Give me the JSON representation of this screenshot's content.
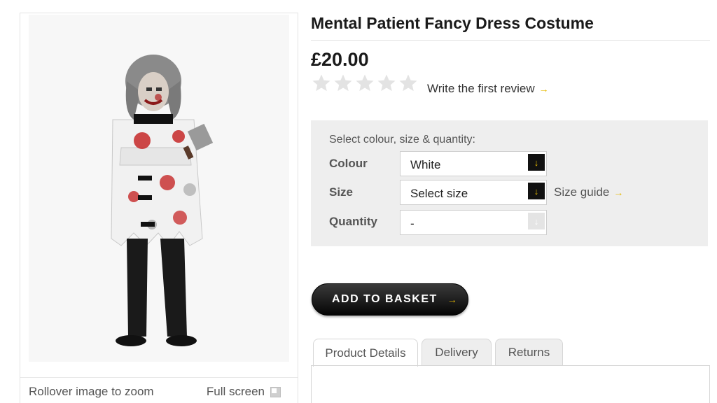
{
  "product": {
    "title": "Mental Patient Fancy Dress Costume",
    "price": "£20.00",
    "rating_stars": 0,
    "rating_max": 5,
    "review_link": "Write the first review"
  },
  "image_panel": {
    "zoom_text": "Rollover image to zoom",
    "fullscreen_label": "Full screen"
  },
  "options": {
    "heading": "Select colour, size & quantity:",
    "colour_label": "Colour",
    "colour_value": "White",
    "size_label": "Size",
    "size_value": "Select size",
    "size_guide": "Size guide",
    "quantity_label": "Quantity",
    "quantity_value": "-"
  },
  "actions": {
    "add_to_basket": "ADD TO BASKET"
  },
  "tabs": [
    {
      "label": "Product Details"
    },
    {
      "label": "Delivery"
    },
    {
      "label": "Returns"
    }
  ],
  "tab_content_partial": "",
  "colors": {
    "accent": "#e6b800",
    "button_dark": "#111111",
    "panel_bg": "#eeeeee",
    "star_empty": "#e3e3e3"
  }
}
